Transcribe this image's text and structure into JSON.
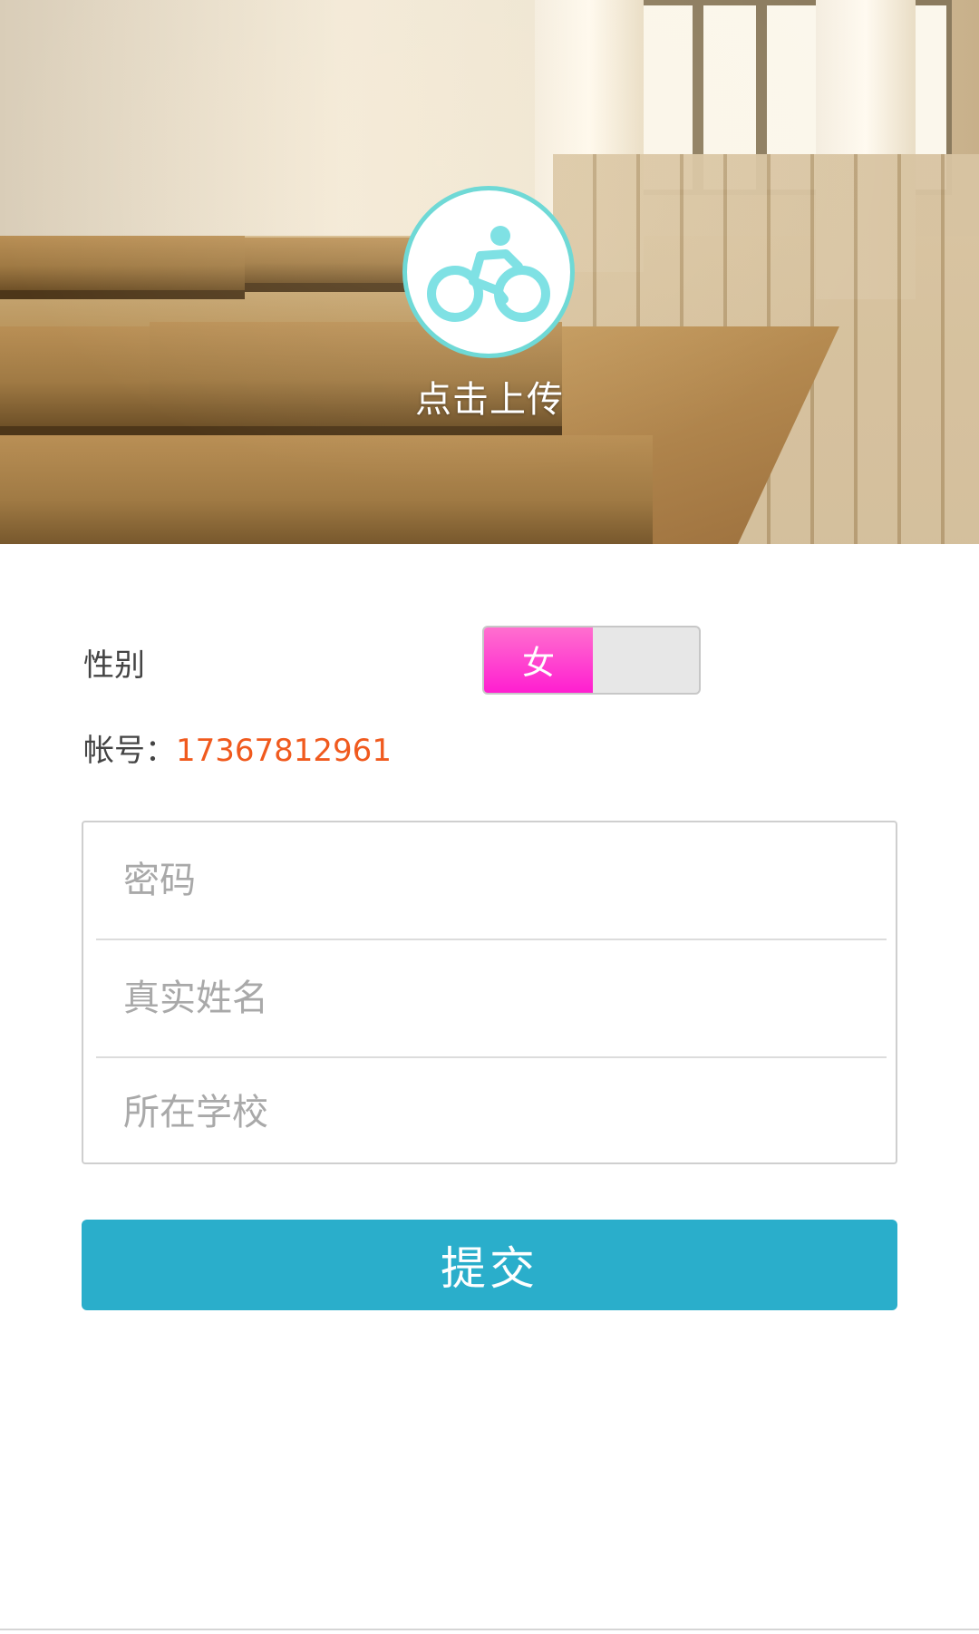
{
  "header": {
    "background_image": "classroom-photo",
    "avatar_icon": "bicycle-rider-icon",
    "avatar_icon_color": "#7fe1e4",
    "upload_label": "点击上传"
  },
  "profile": {
    "gender_label": "性别",
    "gender_value": "女",
    "gender_toggle_color": "#ff1ed0",
    "account_label": "帐号：",
    "account_value": "17367812961",
    "account_value_color": "#f05a1e"
  },
  "form": {
    "password_placeholder": "密码",
    "realname_placeholder": "真实姓名",
    "school_placeholder": "所在学校"
  },
  "actions": {
    "submit_label": "提交",
    "submit_color": "#2aaecb"
  }
}
